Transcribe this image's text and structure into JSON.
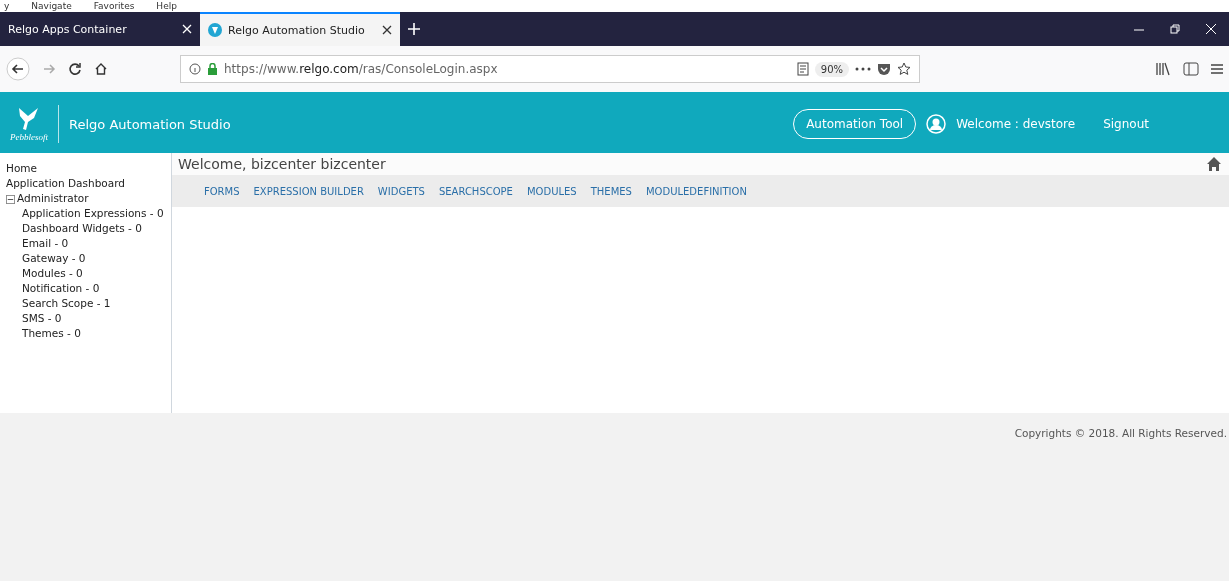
{
  "menu_bar": [
    "y",
    "Navigate",
    "Favorites",
    "Help"
  ],
  "tabs": [
    {
      "label": "Relgo Apps Container",
      "selected": false
    },
    {
      "label": "Relgo Automation Studio",
      "selected": true
    }
  ],
  "address_bar": {
    "url_plain_start": "https://www.",
    "url_domain": "relgo.com",
    "url_path": "/ras/ConsoleLogin.aspx",
    "zoom": "90%"
  },
  "header": {
    "logo_caption": "Pebblesoft",
    "title": "Relgo Automation Studio",
    "tool_button": "Automation Tool",
    "welcome": "Welcome : devstore",
    "signout": "Signout"
  },
  "sidebar": {
    "items": [
      {
        "label": "Home"
      },
      {
        "label": "Application Dashboard"
      },
      {
        "label": "Administrator",
        "expanded": true,
        "children": [
          {
            "label": "Application Expressions - 0"
          },
          {
            "label": "Dashboard Widgets - 0"
          },
          {
            "label": "Email - 0"
          },
          {
            "label": "Gateway - 0"
          },
          {
            "label": "Modules - 0"
          },
          {
            "label": "Notification - 0"
          },
          {
            "label": "Search Scope - 1"
          },
          {
            "label": "SMS - 0"
          },
          {
            "label": "Themes - 0"
          }
        ]
      }
    ]
  },
  "content": {
    "greeting": "Welcome, bizcenter bizcenter",
    "nav": [
      "FORMS",
      "EXPRESSION BUILDER",
      "WIDGETS",
      "SEARCHSCOPE",
      "MODULES",
      "THEMES",
      "MODULEDEFINITION"
    ]
  },
  "footer": {
    "copyright": "Copyrights © 2018. All Rights Reserved."
  }
}
